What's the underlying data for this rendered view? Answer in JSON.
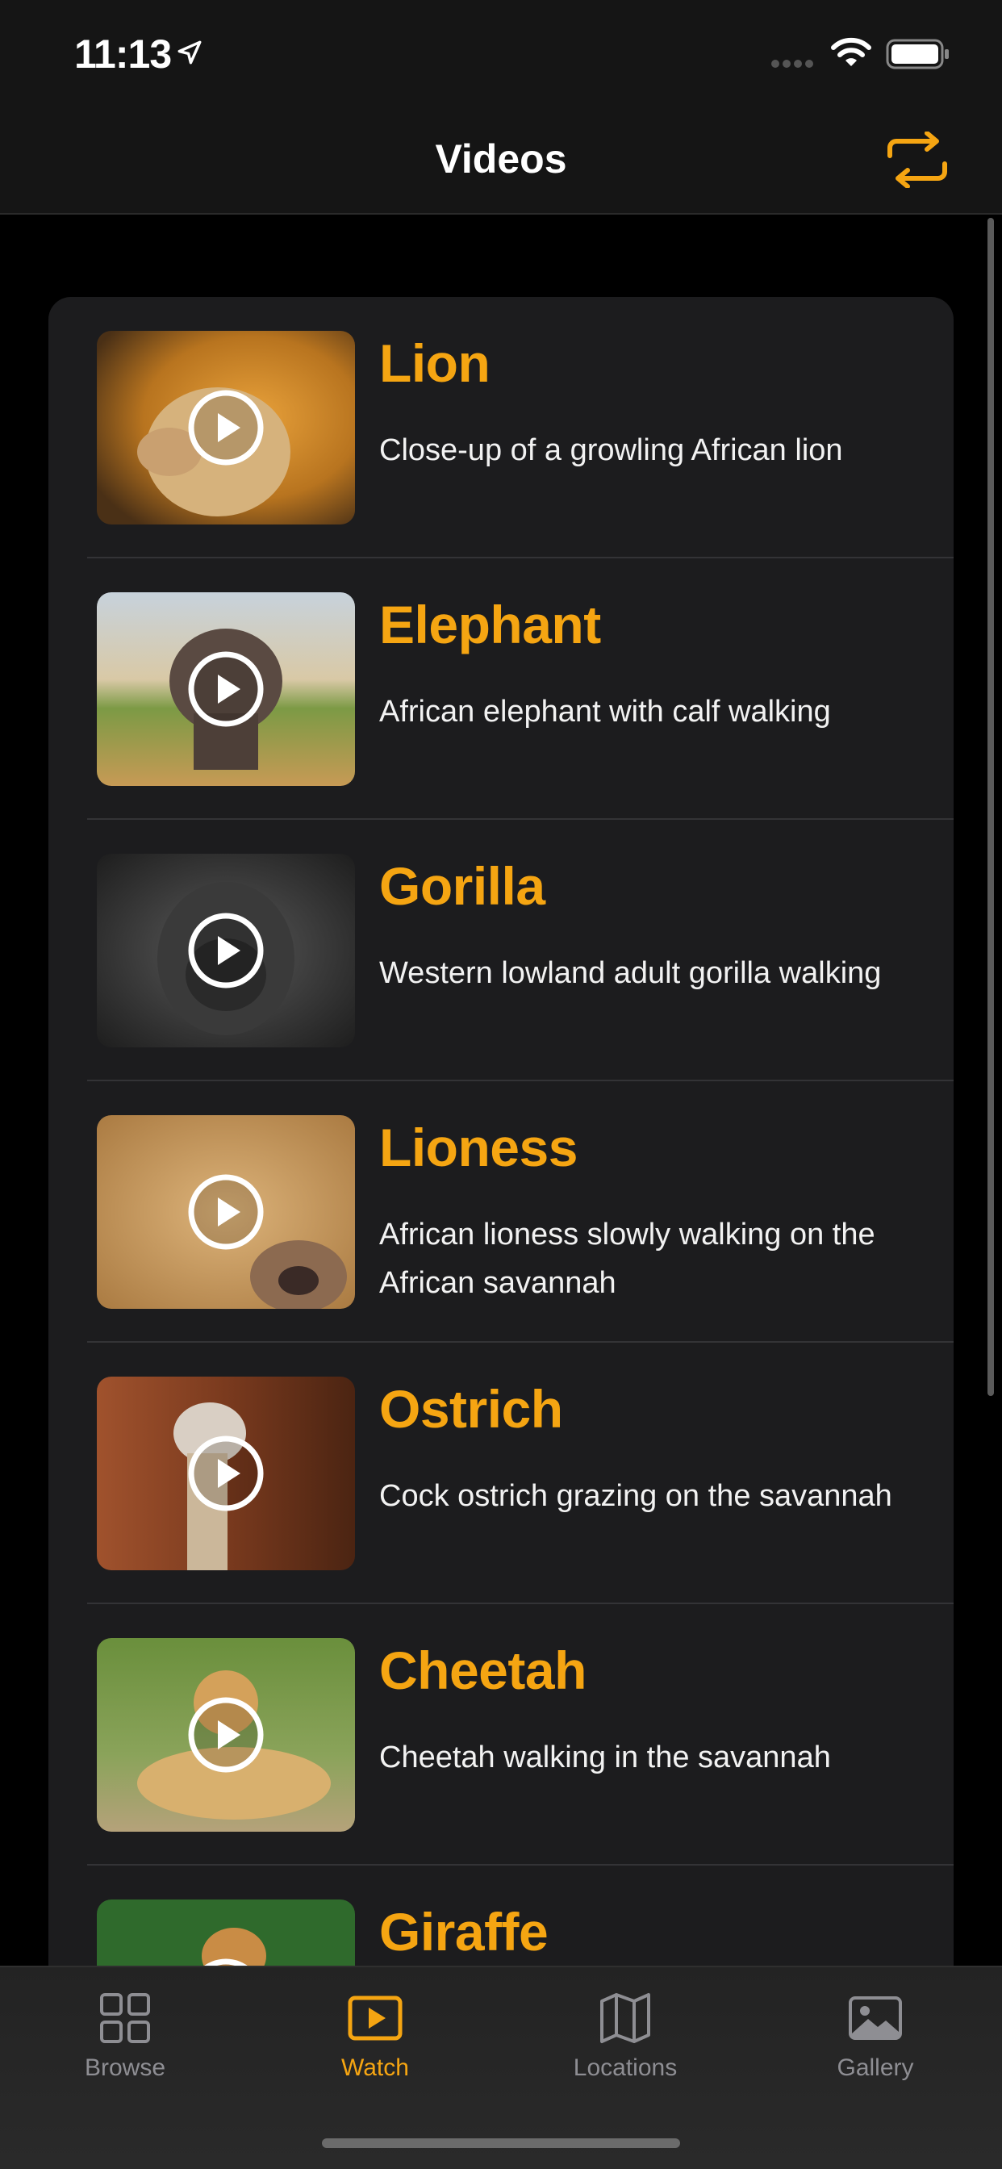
{
  "status_bar": {
    "time": "11:13"
  },
  "nav": {
    "title": "Videos"
  },
  "videos": [
    {
      "title": "Lion",
      "description": "Close-up of a growling African lion"
    },
    {
      "title": "Elephant",
      "description": "African elephant with calf walking"
    },
    {
      "title": "Gorilla",
      "description": "Western lowland adult gorilla walking"
    },
    {
      "title": "Lioness",
      "description": "African lioness slowly walking on the African savannah"
    },
    {
      "title": "Ostrich",
      "description": "Cock ostrich grazing on the savannah"
    },
    {
      "title": "Cheetah",
      "description": "Cheetah walking in the savannah"
    },
    {
      "title": "Giraffe",
      "description": ""
    }
  ],
  "tabs": [
    {
      "label": "Browse",
      "icon": "grid-icon"
    },
    {
      "label": "Watch",
      "icon": "play-rectangle-icon"
    },
    {
      "label": "Locations",
      "icon": "map-icon"
    },
    {
      "label": "Gallery",
      "icon": "photo-icon"
    }
  ],
  "active_tab": "Watch",
  "colors": {
    "accent": "#f5a512",
    "background": "#000000",
    "card": "#1c1c1e"
  }
}
